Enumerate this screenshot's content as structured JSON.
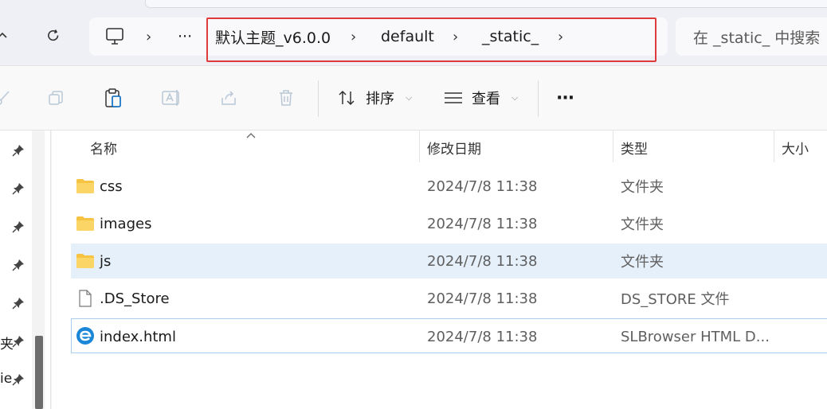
{
  "address": {
    "more_label": "···",
    "crumbs": [
      "默认主题_v6.0.0",
      "default",
      "_static_"
    ]
  },
  "search": {
    "placeholder": "在 _static_ 中搜索"
  },
  "toolbar": {
    "sort_label": "排序",
    "view_label": "查看",
    "more_label": "···"
  },
  "left_pane": {
    "items": [
      "夹",
      "ie"
    ]
  },
  "columns": {
    "name": "名称",
    "modified": "修改日期",
    "type": "类型",
    "size": "大小"
  },
  "files": [
    {
      "name": "css",
      "modified": "2024/7/8 11:38",
      "type": "文件夹",
      "icon": "folder-icon"
    },
    {
      "name": "images",
      "modified": "2024/7/8 11:38",
      "type": "文件夹",
      "icon": "folder-icon"
    },
    {
      "name": "js",
      "modified": "2024/7/8 11:38",
      "type": "文件夹",
      "icon": "folder-icon"
    },
    {
      "name": ".DS_Store",
      "modified": "2024/7/8 11:38",
      "type": "DS_STORE 文件",
      "icon": "file-icon"
    },
    {
      "name": "index.html",
      "modified": "2024/7/8 11:38",
      "type": "SLBrowser HTML D...",
      "icon": "browser-html-icon"
    }
  ],
  "colors": {
    "accent": "#0067c0",
    "folder": "#f6c342",
    "highlight": "#e03b3b",
    "selected_row": "#e6f0fb"
  }
}
